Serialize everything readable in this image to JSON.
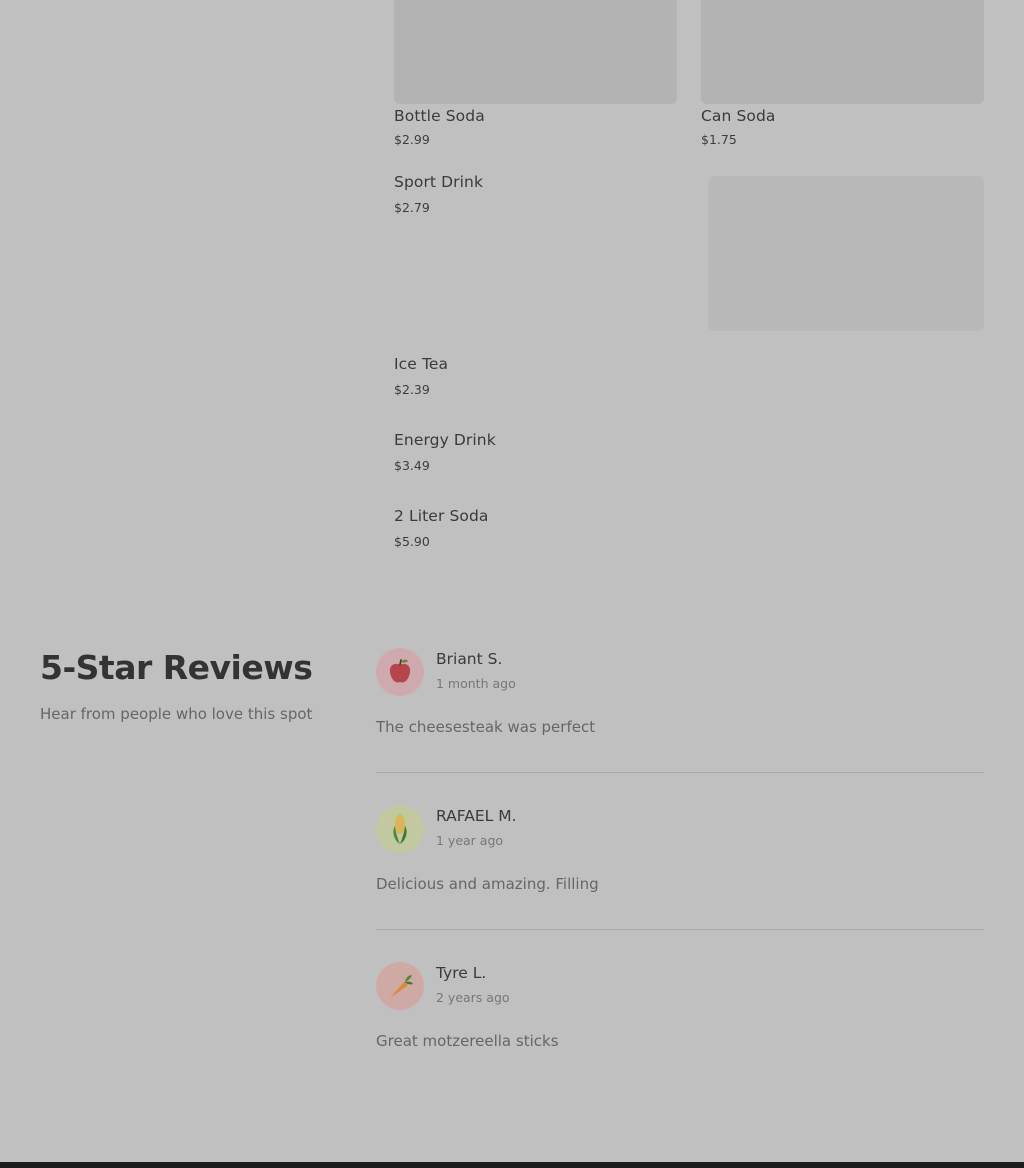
{
  "menu": {
    "items": [
      {
        "name": "Bottle Soda",
        "price": "$2.99"
      },
      {
        "name": "Can Soda",
        "price": "$1.75"
      },
      {
        "name": "Sport Drink",
        "price": "$2.79"
      },
      {
        "name": "Ice Tea",
        "price": "$2.39"
      },
      {
        "name": "Energy Drink",
        "price": "$3.49"
      },
      {
        "name": "2 Liter Soda",
        "price": "$5.90"
      }
    ]
  },
  "reviews": {
    "title": "5-Star Reviews",
    "subtitle": "Hear from people who love this spot",
    "items": [
      {
        "author": "Briant S.",
        "time": "1 month ago",
        "text": "The cheesesteak was perfect",
        "avatar_icon": "apple-icon",
        "avatar_color": "#cfa9ad"
      },
      {
        "author": "RAFAEL M.",
        "time": "1 year ago",
        "text": "Delicious and amazing. Filling",
        "avatar_icon": "corn-icon",
        "avatar_color": "#c2c8a0"
      },
      {
        "author": "Tyre L.",
        "time": "2 years ago",
        "text": "Great motzereella sticks",
        "avatar_icon": "carrot-icon",
        "avatar_color": "#cfaaa4"
      }
    ]
  }
}
